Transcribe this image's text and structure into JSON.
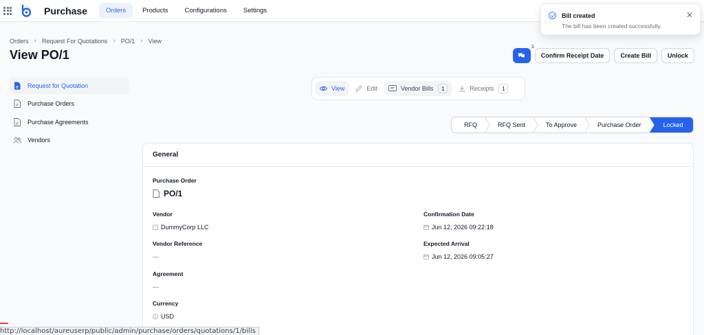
{
  "app": {
    "title": "Purchase"
  },
  "nav": [
    {
      "label": "Orders",
      "active": true
    },
    {
      "label": "Products"
    },
    {
      "label": "Configurations"
    },
    {
      "label": "Settings"
    }
  ],
  "toast": {
    "title": "Bill created",
    "body": "The bill has been created successfully.",
    "accent": "#3b82f6"
  },
  "breadcrumb": [
    "Orders",
    "Request For Quotations",
    "PO/1",
    "View"
  ],
  "page_title": "View PO/1",
  "actions": {
    "chat_badge": "1",
    "confirm_receipt": "Confirm Receipt Date",
    "create_bill": "Create Bill",
    "unlock": "Unlock"
  },
  "sidebar": [
    {
      "label": "Request for Quotation",
      "icon": "document-icon",
      "active": true
    },
    {
      "label": "Purchase Orders",
      "icon": "document-icon"
    },
    {
      "label": "Purchase Agreements",
      "icon": "document-icon"
    },
    {
      "label": "Vendors",
      "icon": "users-icon"
    }
  ],
  "subtabs": {
    "view": "View",
    "edit": "Edit",
    "vendor_bills": "Vendor Bills",
    "vendor_bills_count": "1",
    "receipts": "Receipts",
    "receipts_count": "1"
  },
  "steps": [
    "RFQ",
    "RFQ Sent",
    "To Approve",
    "Purchase Order",
    "Locked"
  ],
  "general": {
    "heading": "General",
    "purchase_order_label": "Purchase Order",
    "purchase_order_value": "PO/1",
    "vendor_label": "Vendor",
    "vendor_value": "DummyCorp LLC",
    "vendor_ref_label": "Vendor Reference",
    "vendor_ref_value": "—",
    "agreement_label": "Agreement",
    "agreement_value": "—",
    "currency_label": "Currency",
    "currency_value": "USD",
    "confirmation_label": "Confirmation Date",
    "confirmation_value": "Jun 12, 2026 09:22:18",
    "expected_label": "Expected Arrival",
    "expected_value": "Jun 12, 2026 09:05:27"
  },
  "status_url": "http://localhost/aureuserp/public/admin/purchase/orders/quotations/1/bills",
  "colors": {
    "primary": "#2563eb"
  }
}
